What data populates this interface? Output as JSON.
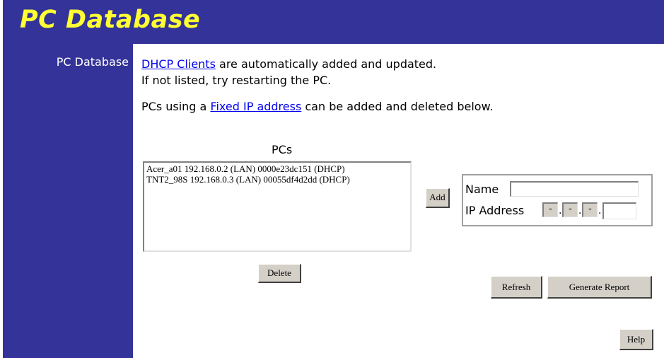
{
  "header": {
    "title": "PC Database"
  },
  "sidebar": {
    "items": [
      {
        "label": "PC Database"
      }
    ]
  },
  "intro": {
    "dhcp_link": "DHCP Clients",
    "line1_rest": " are automatically added and updated.",
    "line2": "If not listed, try restarting the PC.",
    "line3_prefix": "PCs using a ",
    "fixed_ip_link": "Fixed IP address",
    "line3_suffix": " can be added and deleted below."
  },
  "pc_list": {
    "label": "PCs",
    "items": [
      "Acer_a01 192.168.0.2 (LAN) 0000e23dc151 (DHCP)",
      "TNT2_98S 192.168.0.3 (LAN) 00055df4d2dd (DHCP)"
    ]
  },
  "buttons": {
    "add": "Add",
    "delete": "Delete",
    "refresh": "Refresh",
    "generate_report": "Generate Report",
    "help": "Help"
  },
  "add_form": {
    "name_label": "Name",
    "name_value": "",
    "ip_label": "IP Address",
    "ip_octets": [
      "-",
      "-",
      "-",
      ""
    ]
  },
  "colors": {
    "background_blue": "#333399",
    "title_yellow": "#ffff33",
    "link_blue": "#0000ee",
    "button_gray": "#d4d0c8"
  }
}
